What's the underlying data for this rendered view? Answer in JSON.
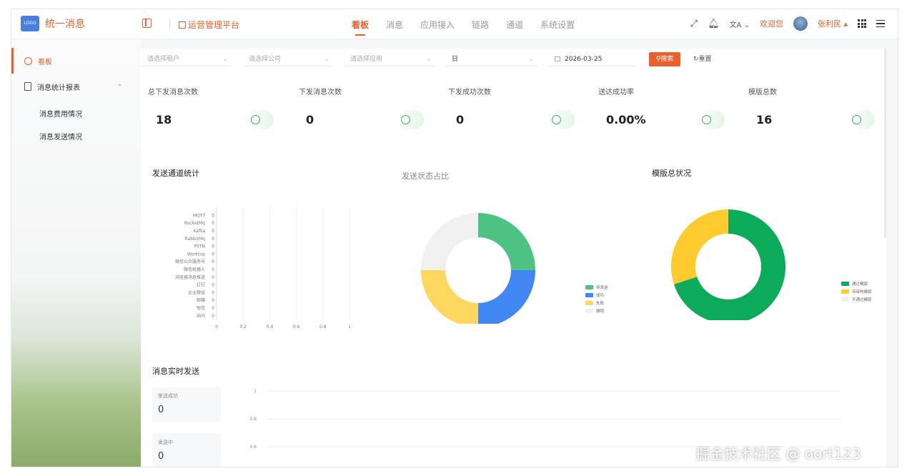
{
  "header": {
    "logo_text": "LOGO",
    "app_title": "统一消息",
    "platform": "运营管理平台",
    "nav": [
      {
        "label": "看板",
        "active": true
      },
      {
        "label": "消息",
        "active": false
      },
      {
        "label": "应用接入",
        "active": false
      },
      {
        "label": "链路",
        "active": false
      },
      {
        "label": "通道",
        "active": false
      },
      {
        "label": "系统设置",
        "active": false
      }
    ],
    "lang_icon": "文A",
    "welcome": "欢迎您",
    "user": "张利民"
  },
  "sidebar": {
    "items": [
      {
        "label": "看板",
        "icon": "home-icon",
        "active": true
      },
      {
        "label": "消息统计报表",
        "icon": "doc-icon",
        "expanded": true
      }
    ],
    "sub_items": [
      "消息费用情况",
      "消息发送情况"
    ]
  },
  "filters": {
    "tenant_placeholder": "请选择租户",
    "company_placeholder": "请选择公司",
    "app_placeholder": "请选择应用",
    "period": "日",
    "date": "2026-03-25",
    "search_label": "搜索",
    "reset_label": "重置"
  },
  "stats": [
    {
      "label": "总下发消息次数",
      "value": "18"
    },
    {
      "label": "下发消息次数",
      "value": "0"
    },
    {
      "label": "下发成功次数",
      "value": "0"
    },
    {
      "label": "送达成功率",
      "value": "0.00%"
    },
    {
      "label": "模版总数",
      "value": "16"
    }
  ],
  "sections": {
    "channel_stats": "发送通道统计",
    "status_ratio": "发送状态占比",
    "template_status": "模版总状况",
    "realtime": "消息实时发送"
  },
  "realtime_cards": [
    {
      "label": "发送成功",
      "value": "0"
    },
    {
      "label": "发送中",
      "value": "0"
    }
  ],
  "chart_data": [
    {
      "type": "bar",
      "orientation": "horizontal",
      "categories": [
        "MQTT",
        "RocketMq",
        "Kafka",
        "RabbitMq",
        "PSTN",
        "Worktop",
        "微信公众服务号",
        "微信机器人",
        "浏览器消息推送",
        "钉钉",
        "企业微信",
        "邮箱",
        "短信",
        "站内"
      ],
      "values": [
        0,
        0,
        0,
        0,
        0,
        0,
        0,
        0,
        0,
        0,
        0,
        0,
        0,
        0
      ],
      "x_ticks": [
        "0",
        "0.2",
        "0.4",
        "0.6",
        "0.8",
        "1"
      ],
      "xlim": [
        0,
        1
      ]
    },
    {
      "type": "pie",
      "title": "发送状态占比",
      "labels": [
        "待发送",
        "成功",
        "失败",
        "撤销"
      ],
      "values": [
        25,
        25,
        25,
        25
      ],
      "colors": [
        "#4ec282",
        "#4188f5",
        "#ffd75e",
        "#f0f0f0"
      ],
      "legend": "right"
    },
    {
      "type": "pie",
      "labels": [
        "通过模版",
        "待审核模版",
        "不通过模版"
      ],
      "values": [
        14,
        6,
        0
      ],
      "colors": [
        "#0bab5a",
        "#ffcb2f",
        "#f0f0f0"
      ],
      "legend": "right"
    },
    {
      "type": "line",
      "y_ticks": [
        "1",
        "0.8",
        "0.6"
      ]
    }
  ],
  "watermark": "掘金技术社区 @ oort123"
}
